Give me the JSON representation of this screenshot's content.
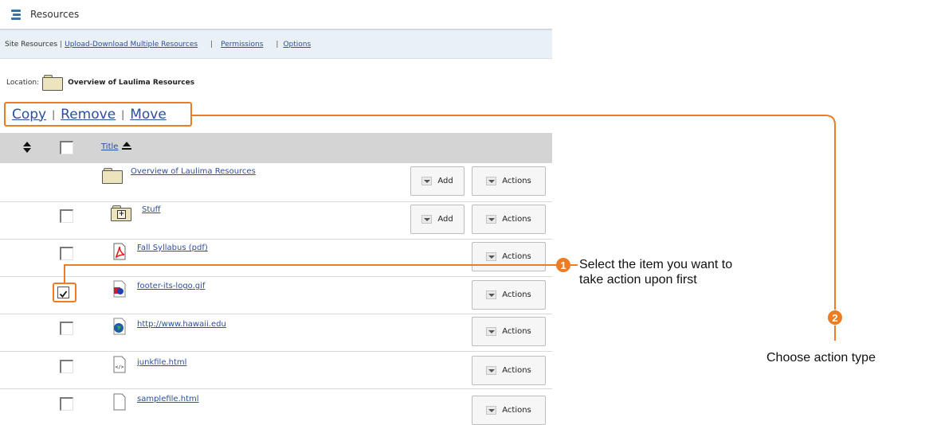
{
  "header": {
    "title": "Resources",
    "icon": "resources-icon"
  },
  "nav": {
    "site_resources": "Site Resources",
    "upload_download": "Upload-Download Multiple Resources",
    "permissions": "Permissions",
    "options": "Options"
  },
  "location": {
    "label": "Location:",
    "name": "Overview of Laulima Resources"
  },
  "bulk_actions": {
    "copy": "Copy",
    "remove": "Remove",
    "move": "Move"
  },
  "table": {
    "title_header": "Title",
    "add_label": "Add",
    "actions_label": "Actions",
    "rows": [
      {
        "name": "Overview of Laulima Resources",
        "icon": "folder-icon",
        "checked": false
      },
      {
        "name": "Stuff",
        "icon": "folder-add-icon",
        "checked": false
      },
      {
        "name": "Fall Syllabus (pdf)",
        "icon": "pdf-icon",
        "checked": false
      },
      {
        "name": "footer-its-logo.gif",
        "icon": "image-icon",
        "checked": true
      },
      {
        "name": "http://www.hawaii.edu",
        "icon": "weblink-icon",
        "checked": false
      },
      {
        "name": "junkfile.html",
        "icon": "html-icon",
        "checked": false
      },
      {
        "name": "samplefile.html",
        "icon": "html-icon",
        "checked": false
      }
    ]
  },
  "annotations": {
    "step1_number": "1",
    "step1_text_line1": "Select the item you want to",
    "step1_text_line2": "take action upon first",
    "step2_number": "2",
    "step2_text": "Choose action type"
  },
  "colors": {
    "accent": "#ef7c22",
    "link": "#2c4f9e",
    "header_bg": "#d4d4d4",
    "nav_bg": "#eaf1f6"
  }
}
